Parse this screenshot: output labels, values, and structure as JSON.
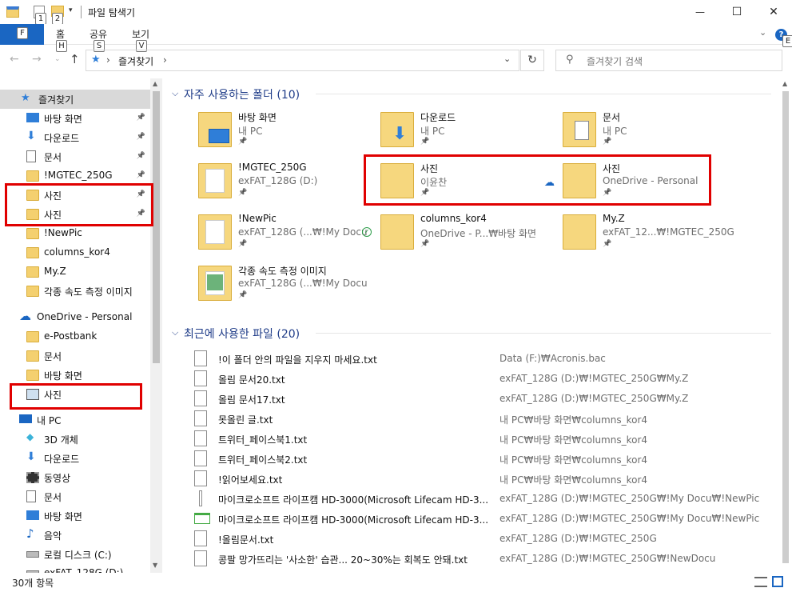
{
  "window": {
    "title": "파일 탐색기",
    "minimize": "—",
    "maximize": "☐",
    "close": "✕"
  },
  "qat_keytips": [
    "1",
    "2"
  ],
  "ribbon": {
    "file_keytip": "F",
    "tabs": [
      {
        "label": "홈",
        "keytip": "H"
      },
      {
        "label": "공유",
        "keytip": "S"
      },
      {
        "label": "보기",
        "keytip": "V"
      }
    ],
    "help_keytip": "E"
  },
  "address": {
    "path": "즐겨찾기",
    "separator": "›",
    "search_placeholder": "즐겨찾기 검색"
  },
  "nav": {
    "quick_access": "즐겨찾기",
    "quick_items": [
      {
        "label": "바탕 화면",
        "pinned": true
      },
      {
        "label": "다운로드",
        "pinned": true
      },
      {
        "label": "문서",
        "pinned": true
      },
      {
        "label": "!MGTEC_250G",
        "pinned": true
      },
      {
        "label": "사진",
        "pinned": true
      },
      {
        "label": "사진",
        "pinned": true
      },
      {
        "label": "!NewPic",
        "pinned": false
      },
      {
        "label": "columns_kor4",
        "pinned": false
      },
      {
        "label": "My.Z",
        "pinned": false
      },
      {
        "label": "각종 속도 측정 이미지",
        "pinned": false
      }
    ],
    "onedrive": "OneDrive - Personal",
    "onedrive_items": [
      "e-Postbank",
      "문서",
      "바탕 화면",
      "사진"
    ],
    "thispc": "내 PC",
    "pc_items": [
      "3D 개체",
      "다운로드",
      "동영상",
      "문서",
      "바탕 화면",
      "음악",
      "로컬 디스크 (C:)",
      "exFAT_128G (D:)"
    ]
  },
  "frequent": {
    "header": "자주 사용하는 폴더 (10)",
    "tiles": [
      {
        "name": "바탕 화면",
        "sub": "내 PC"
      },
      {
        "name": "다운로드",
        "sub": "내 PC"
      },
      {
        "name": "문서",
        "sub": "내 PC"
      },
      {
        "name": "!MGTEC_250G",
        "sub": "exFAT_128G (D:)"
      },
      {
        "name": "사진",
        "sub": "이윤찬"
      },
      {
        "name": "사진",
        "sub": "OneDrive - Personal"
      },
      {
        "name": "!NewPic",
        "sub": "exFAT_128G (...₩!My Docu"
      },
      {
        "name": "columns_kor4",
        "sub": "OneDrive - P...₩바탕 화면"
      },
      {
        "name": "My.Z",
        "sub": "exFAT_12...₩!MGTEC_250G"
      },
      {
        "name": "각종 속도 측정 이미지",
        "sub": "exFAT_128G (...₩!My Docu"
      }
    ]
  },
  "recent": {
    "header": "최근에 사용한 파일 (20)",
    "files": [
      {
        "name": "!이 폴더 안의 파일을 지우지 마세요.txt",
        "path": "Data (F:)₩Acronis.bac"
      },
      {
        "name": "올림 문서20.txt",
        "path": "exFAT_128G (D:)₩!MGTEC_250G₩My.Z"
      },
      {
        "name": "올림 문서17.txt",
        "path": "exFAT_128G (D:)₩!MGTEC_250G₩My.Z"
      },
      {
        "name": "못올린 글.txt",
        "path": "내 PC₩바탕 화면₩columns_kor4"
      },
      {
        "name": "트위터_페이스북1.txt",
        "path": "내 PC₩바탕 화면₩columns_kor4"
      },
      {
        "name": "트위터_페이스북2.txt",
        "path": "내 PC₩바탕 화면₩columns_kor4"
      },
      {
        "name": "!읽어보세요.txt",
        "path": "내 PC₩바탕 화면₩columns_kor4"
      },
      {
        "name": "마이크로소프트 라이프캠 HD-3000(Microsoft Lifecam HD-3...",
        "path": "exFAT_128G (D:)₩!MGTEC_250G₩!My Docu₩!NewPic"
      },
      {
        "name": "마이크로소프트 라이프캠 HD-3000(Microsoft Lifecam HD-3...",
        "path": "exFAT_128G (D:)₩!MGTEC_250G₩!My Docu₩!NewPic"
      },
      {
        "name": "!올림문서.txt",
        "path": "exFAT_128G (D:)₩!MGTEC_250G"
      },
      {
        "name": "콩팔 망가뜨리는 '사소한' 습관... 20~30%는 회복도 안돼.txt",
        "path": "exFAT_128G (D:)₩!MGTEC_250G₩!NewDocu"
      }
    ]
  },
  "status": {
    "count": "30개 항목"
  },
  "colors": {
    "accent": "#1a66c2",
    "highlight": "#e00000",
    "folder": "#f4d06f"
  }
}
